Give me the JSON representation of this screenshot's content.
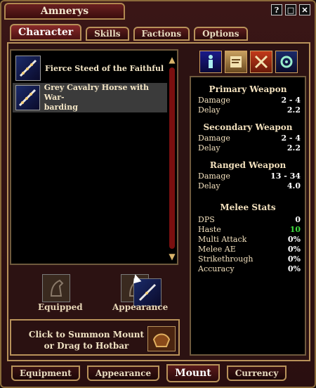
{
  "window": {
    "title": "Amnerys",
    "controls": [
      "?",
      "□",
      "✕"
    ]
  },
  "tabs": [
    {
      "label": "Character",
      "active": true
    },
    {
      "label": "Skills",
      "active": false
    },
    {
      "label": "Factions",
      "active": false
    },
    {
      "label": "Options",
      "active": false
    }
  ],
  "mounts": {
    "items": [
      {
        "name": "Fierce Steed of the Faithful",
        "selected": false
      },
      {
        "name": "Grey Cavalry Horse with War-\nbarding",
        "selected": true
      }
    ]
  },
  "slots": {
    "equipped_label": "Equipped",
    "appearance_label": "Appearance"
  },
  "summon": {
    "text": "Click to Summon Mount or Drag to Hotbar"
  },
  "stats": {
    "primary": {
      "title": "Primary Weapon",
      "damage_label": "Damage",
      "damage": "2 - 4",
      "delay_label": "Delay",
      "delay": "2.2"
    },
    "secondary": {
      "title": "Secondary Weapon",
      "damage_label": "Damage",
      "damage": "2 - 4",
      "delay_label": "Delay",
      "delay": "2.2"
    },
    "ranged": {
      "title": "Ranged Weapon",
      "damage_label": "Damage",
      "damage": "13 - 34",
      "delay_label": "Delay",
      "delay": "4.0"
    },
    "melee": {
      "title": "Melee Stats",
      "rows": [
        {
          "label": "DPS",
          "value": "0",
          "color": "#ffffff"
        },
        {
          "label": "Haste",
          "value": "10",
          "color": "#3fdc3f"
        },
        {
          "label": "Multi Attack",
          "value": "0%",
          "color": "#ffffff"
        },
        {
          "label": "Melee AE",
          "value": "0%",
          "color": "#ffffff"
        },
        {
          "label": "Strikethrough",
          "value": "0%",
          "color": "#ffffff"
        },
        {
          "label": "Accuracy",
          "value": "0%",
          "color": "#ffffff"
        }
      ]
    }
  },
  "bottom_tabs": [
    {
      "label": "Equipment",
      "active": false
    },
    {
      "label": "Appearance",
      "active": false
    },
    {
      "label": "Mount",
      "active": true
    },
    {
      "label": "Currency",
      "active": false
    }
  ],
  "icons": [
    "character-icon",
    "scroll-icon",
    "combat-icon",
    "settings-icon"
  ]
}
